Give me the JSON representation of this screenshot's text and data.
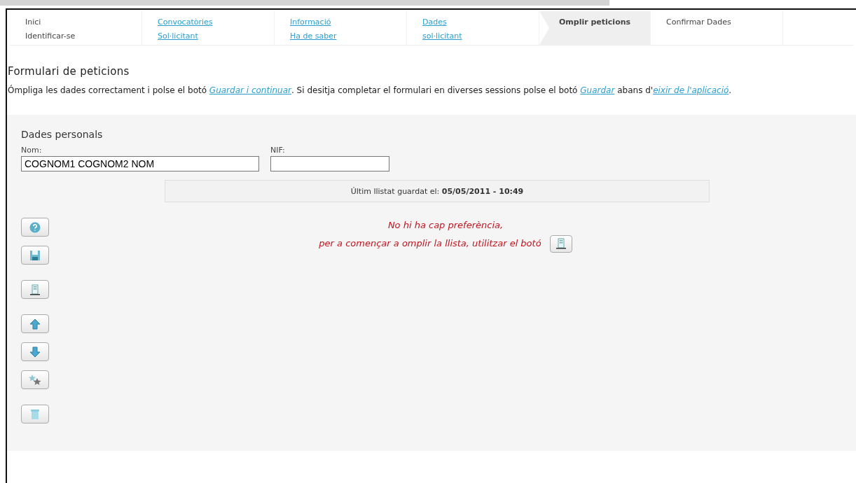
{
  "steps": [
    {
      "lines": [
        "Inici",
        "Identificar-se"
      ],
      "link": false,
      "selected": false
    },
    {
      "lines": [
        "Convocatòries",
        "Sol·licitant"
      ],
      "link": true,
      "selected": false
    },
    {
      "lines": [
        "Informació",
        "Ha de saber"
      ],
      "link": true,
      "selected": false
    },
    {
      "lines": [
        "Dades",
        "sol·licitant"
      ],
      "link": true,
      "selected": false
    },
    {
      "lines": [
        "Omplir peticions"
      ],
      "link": false,
      "selected": true
    },
    {
      "lines": [
        "Confirmar Dades"
      ],
      "link": false,
      "selected": false
    }
  ],
  "title": "Formulari de peticions",
  "intro": [
    "Ómpliga les dades correctament i polse el botó ",
    {
      "link": "Guardar i continuar"
    },
    ". Si desitja completar el formulari en diverses sessions polse el botó ",
    {
      "link": "Guardar"
    },
    " abans d'",
    {
      "link": "eixir de l'aplicació"
    },
    "."
  ],
  "section_title": "Dades personals",
  "fields": [
    {
      "label": "Nom:",
      "value": "COGNOM1 COGNOM2 NOM"
    },
    {
      "label": "NIF:"
    }
  ],
  "last_saved": {
    "label": "Últim llistat guardat el: ",
    "value": "05/05/2011 - 10:49"
  },
  "message": [
    "No hi ha cap preferència,",
    "per a començar a omplir la llista, utilitzar el botó"
  ],
  "tools": [
    {
      "kind": "help"
    },
    {
      "kind": "save"
    },
    {
      "kind": "add"
    },
    {
      "kind": "up"
    },
    {
      "kind": "down"
    },
    {
      "kind": "star"
    },
    {
      "kind": "delete"
    }
  ]
}
